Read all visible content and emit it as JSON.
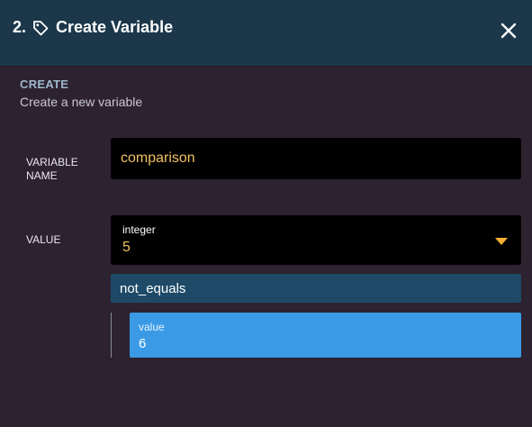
{
  "header": {
    "step_number": "2.",
    "title": "Create Variable",
    "icon": "tag-icon",
    "close_icon": "close-icon"
  },
  "section": {
    "title": "CREATE",
    "subtitle": "Create a new variable"
  },
  "form": {
    "variable_name_label": "VARIABLE NAME",
    "variable_name_value": "comparison",
    "value_label": "VALUE",
    "type_caption": "integer",
    "type_value": "5",
    "operator": "not_equals",
    "operand_caption": "value",
    "operand_value": "6"
  },
  "colors": {
    "header_bg": "#1c374a",
    "page_bg": "#2c2230",
    "input_text": "#f2c063",
    "operator_bg": "#1e4a68",
    "operand_bg": "#3a9ae6"
  }
}
